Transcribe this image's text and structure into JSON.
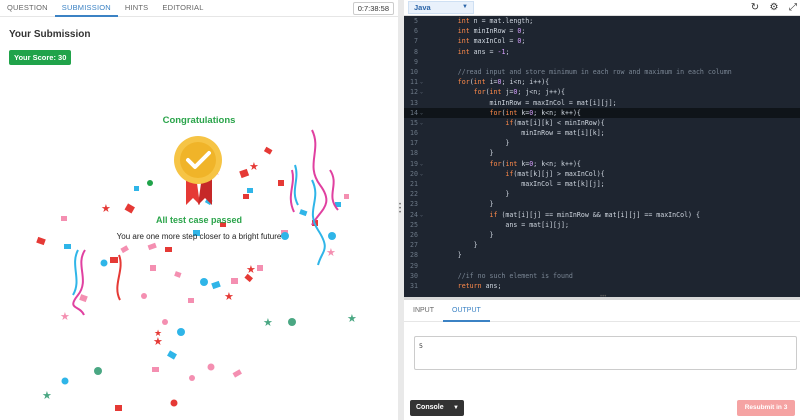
{
  "left_tabs": [
    "QUESTION",
    "SUBMISSION",
    "HINTS",
    "EDITORIAL"
  ],
  "timer": "0:7:38:58",
  "submission": {
    "title": "Your Submission",
    "score": "Your Score: 30",
    "congrats": "Congratulations",
    "passed": "All test case passed",
    "message": "You are one more step closer to a bright future"
  },
  "editor": {
    "language": "Java",
    "tool_icons": [
      "reset-icon",
      "settings-icon",
      "fullscreen-icon"
    ],
    "line_numbers": [
      "5",
      "6",
      "7",
      "8",
      "9",
      "10",
      "11",
      "12",
      "13",
      "14",
      "15",
      "16",
      "17",
      "18",
      "19",
      "20",
      "21",
      "22",
      "23",
      "24",
      "25",
      "26",
      "27",
      "28",
      "29",
      "30",
      "31"
    ]
  },
  "io": {
    "tabs": [
      "INPUT",
      "OUTPUT"
    ],
    "output_value": "5"
  },
  "console_label": "Console",
  "resubmit_label": "Resubmit in 3",
  "colors": {
    "accent_blue": "#3b82c4",
    "success_green": "#20a34a",
    "editor_bg": "#1e2530",
    "resubmit_bg": "#f5a3a3"
  }
}
